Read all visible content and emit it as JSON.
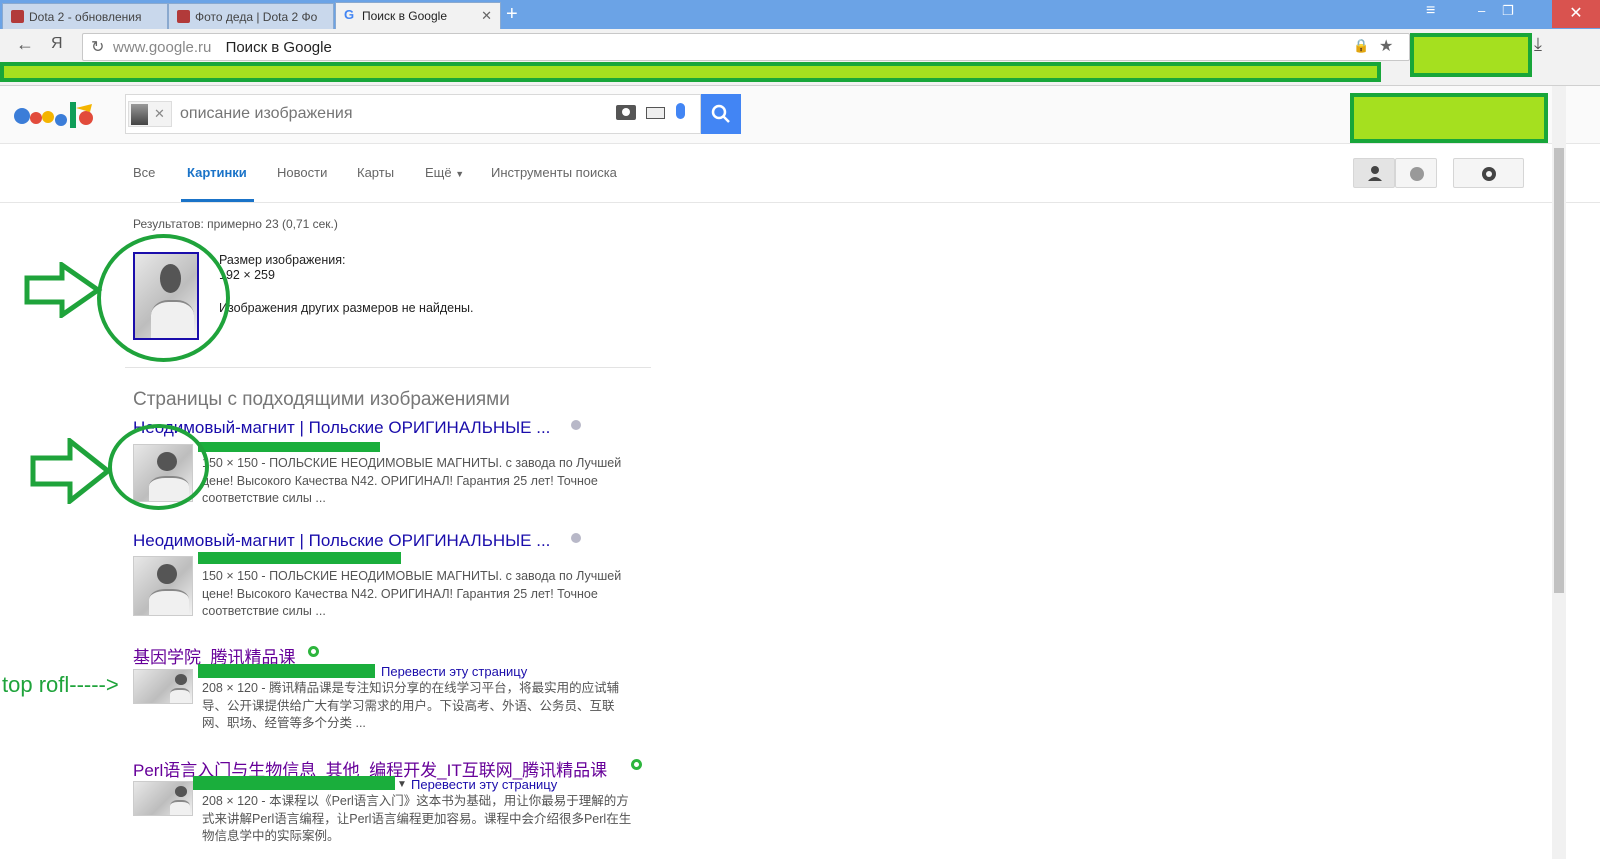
{
  "browser": {
    "tabs": [
      {
        "title": "Dota 2 - обновления"
      },
      {
        "title": "Фото деда | Dota 2 Фо"
      },
      {
        "title": "Поиск в Google"
      }
    ],
    "address": {
      "host": "www.google.ru",
      "title": "Поиск в Google"
    }
  },
  "search": {
    "placeholder": "описание изображения",
    "button_icon": "magnifier-icon"
  },
  "nav": {
    "items": [
      "Все",
      "Картинки",
      "Новости",
      "Карты",
      "Ещё",
      "Инструменты поиска"
    ],
    "active": "Картинки"
  },
  "results": {
    "stats": "Результатов: примерно 23 (0,71 сек.)",
    "size_label": "Размер изображения:",
    "size_value": "192 × 259",
    "no_other_sizes": "Изображения других размеров не найдены.",
    "section_heading": "Страницы с подходящими изображениями",
    "items": [
      {
        "title": "Неодимовый-магнит | Польские ОРИГИНАЛЬНЫЕ ...",
        "snippet_1": "150 × 150 - ПОЛЬСКИЕ НЕОДИМОВЫЕ МАГНИТЫ. с завода по Лучшей",
        "snippet_2": "цене! Высокого Качества N42. ОРИГИНАЛ! Гарантия 25 лет! Точное",
        "snippet_3": "соответствие силы ..."
      },
      {
        "title": "Неодимовый-магнит | Польские ОРИГИНАЛЬНЫЕ ...",
        "snippet_1": "150 × 150 - ПОЛЬСКИЕ НЕОДИМОВЫЕ МАГНИТЫ. с завода по Лучшей",
        "snippet_2": "цене! Высокого Качества N42. ОРИГИНАЛ! Гарантия 25 лет! Точное",
        "snippet_3": "соответствие силы ..."
      },
      {
        "title": "基因学院_腾讯精品课",
        "translate": "Перевести эту страницу",
        "snippet_1": "208 × 120 - 腾讯精品课是专注知识分享的在线学习平台，将最实用的应试辅",
        "snippet_2": "导、公开课提供给广大有学习需求的用户。下设高考、外语、公务员、互联",
        "snippet_3": "网、职场、经管等多个分类 ..."
      },
      {
        "title": "Perl语言入门与生物信息_其他_编程开发_IT互联网_腾讯精品课",
        "translate": "Перевести эту страницу",
        "snippet_1": "208 × 120 - 本课程以《Perl语言入门》这本书为基础，用让你最易于理解的方",
        "snippet_2": "式来讲解Perl语言编程，让Perl语言编程更加容易。课程中会介绍很多Perl在生",
        "snippet_3": "物信息学中的实际案例。"
      }
    ]
  },
  "annotation": {
    "label": "top rofl----->"
  },
  "colors": {
    "annotation_green": "#1fa33b",
    "highlight": "#a5e01f",
    "link": "#1a0dab",
    "accent": "#4285f4"
  }
}
